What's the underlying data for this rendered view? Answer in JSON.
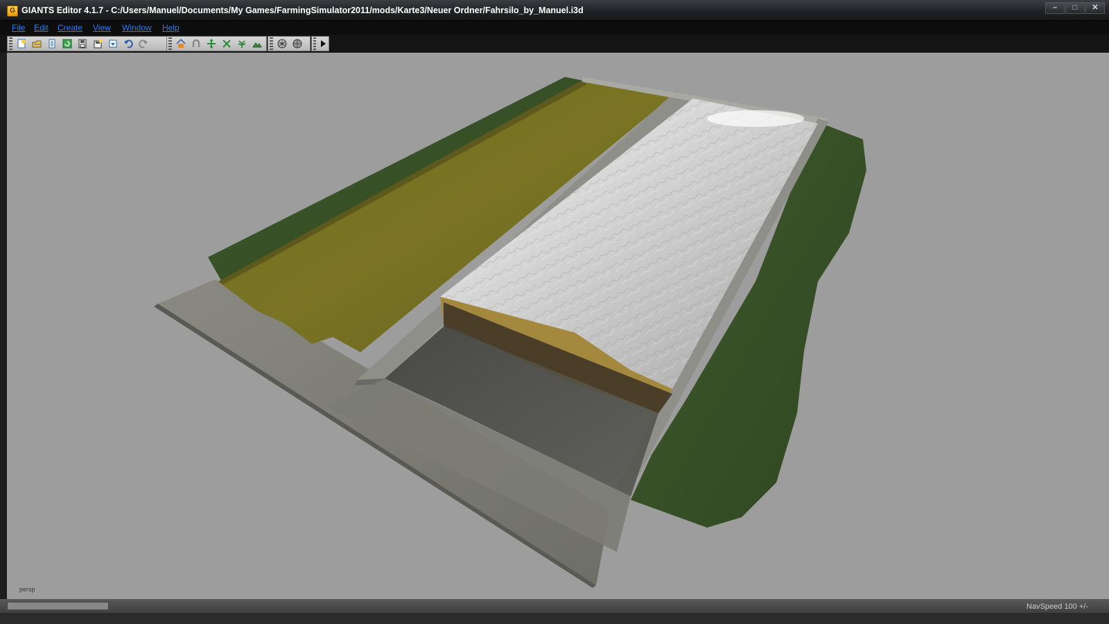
{
  "window": {
    "app_icon": "giants-editor-icon",
    "title": "GIANTS Editor 4.1.7 - C:/Users/Manuel/Documents/My Games/FarmingSimulator2011/mods/Karte3/Neuer Ordner/Fahrsilo_by_Manuel.i3d",
    "minimize": "–",
    "maximize": "□",
    "close": "✕"
  },
  "menu": {
    "items": [
      "File",
      "Edit",
      "Create",
      "View",
      "Window",
      "Help"
    ]
  },
  "toolbar": {
    "icons": [
      "new-scene-icon",
      "open-icon",
      "document-icon",
      "reload-icon",
      "save-icon",
      "save-as-icon",
      "import-icon",
      "undo-icon",
      "redo-icon",
      "home-icon",
      "magnet-icon",
      "move-icon",
      "scale-icon",
      "plant-icon",
      "terrain-icon",
      "wire-icon",
      "solid-icon",
      "play-icon"
    ]
  },
  "viewport": {
    "camera_label": "persp",
    "background_color": "#9d9d9d"
  },
  "status": {
    "nav_speed": "NavSpeed 100 +/-"
  }
}
